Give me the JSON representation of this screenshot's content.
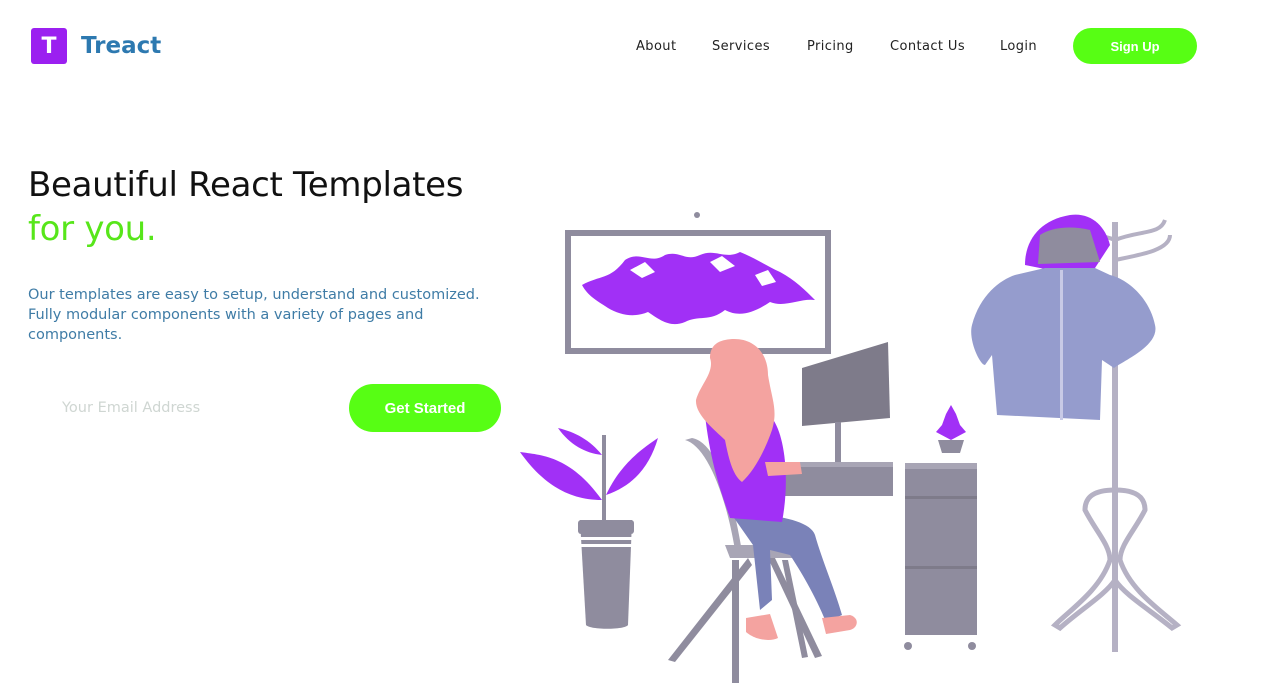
{
  "brand": {
    "logo_letter": "T",
    "name": "Treact",
    "logo_color": "#9b20f0",
    "name_color": "#2d79b0"
  },
  "nav": {
    "items": [
      {
        "label": "About"
      },
      {
        "label": "Services"
      },
      {
        "label": "Pricing"
      },
      {
        "label": "Contact Us"
      },
      {
        "label": "Login"
      }
    ],
    "signup_label": "Sign Up"
  },
  "hero": {
    "title": "Beautiful React Templates",
    "title_accent": "for you.",
    "description": "Our templates are easy to setup, understand and customized. Fully modular components with a variety of pages and components.",
    "email_placeholder": "Your Email Address",
    "cta_label": "Get Started"
  },
  "colors": {
    "accent_green": "#57fe14",
    "purple": "#9b20f0",
    "text_blue": "#3f7ca6"
  },
  "illustration": {
    "icon": "woman-at-desk-illustration"
  }
}
